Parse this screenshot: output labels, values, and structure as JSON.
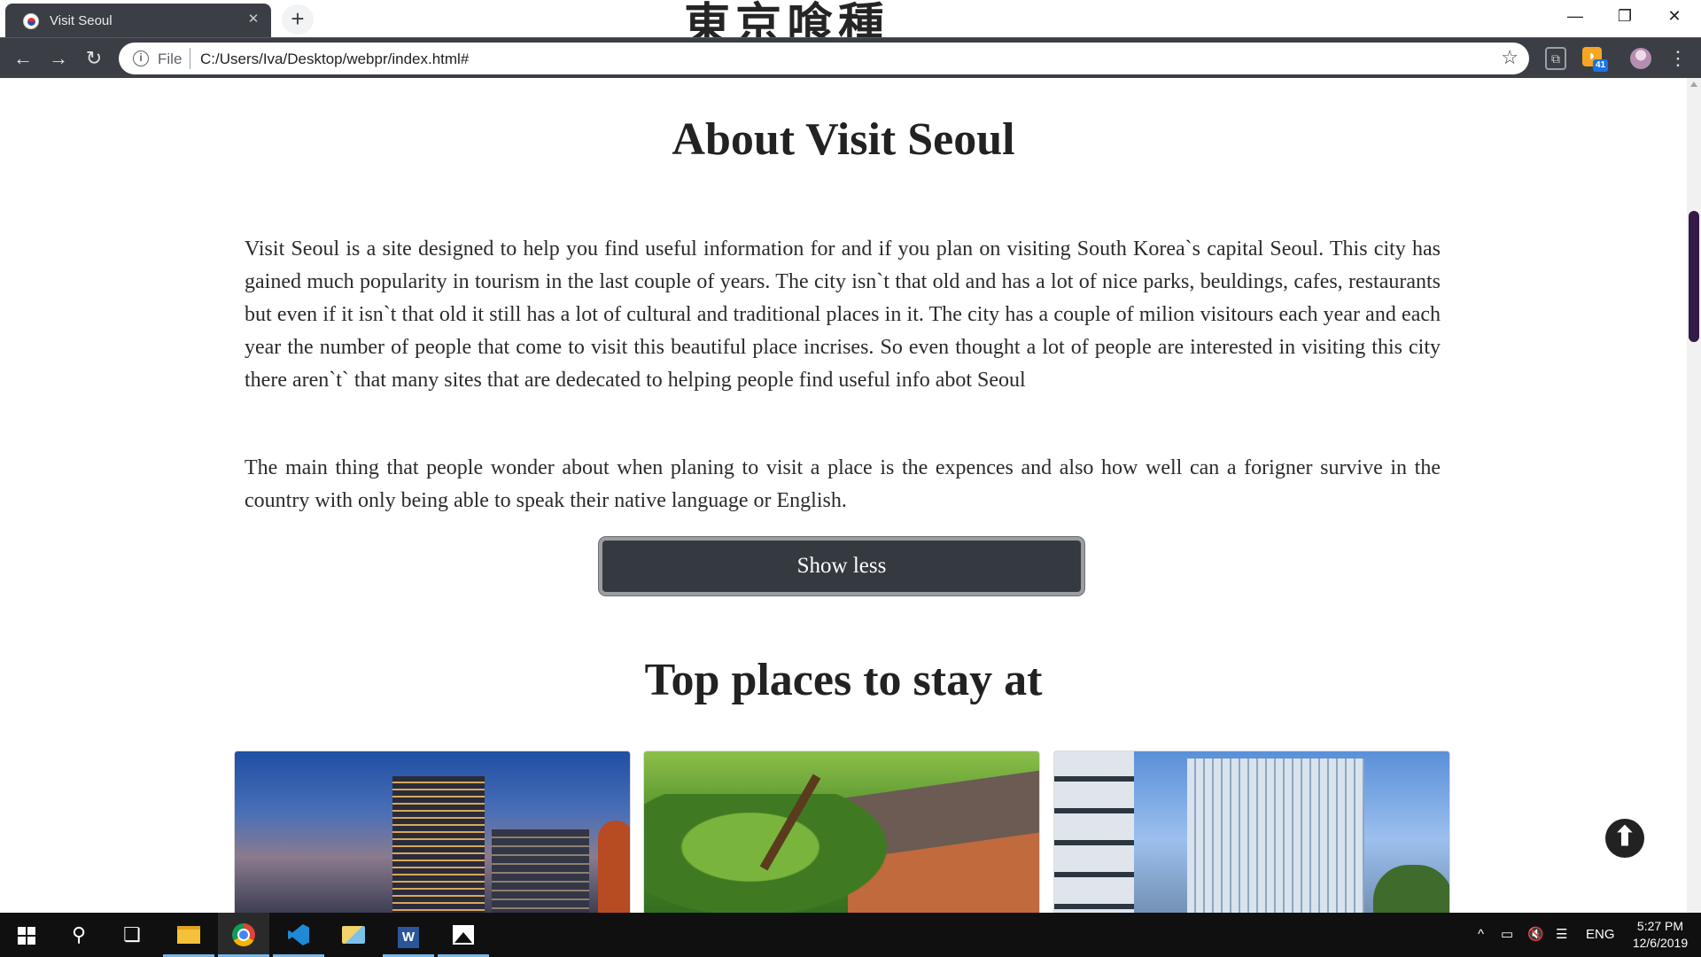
{
  "browser": {
    "tab_title": "Visit Seoul",
    "tab_close": "✕",
    "new_tab": "+",
    "banner_text": "東京喰種",
    "window_controls": {
      "minimize": "—",
      "restore": "❐",
      "close": "✕"
    },
    "nav": {
      "back": "←",
      "forward": "→",
      "reload": "↻"
    },
    "omnibox": {
      "info_icon": "i",
      "scheme": "File",
      "url": "C:/Users/Iva/Desktop/webpr/index.html#",
      "bookmark_icon": "☆"
    },
    "extensions": {
      "ext1": "⧉",
      "rss_icon": "◗",
      "rss_badge": "41"
    },
    "menu": "⋮"
  },
  "page": {
    "about_title": "About Visit Seoul",
    "paragraph1": "Visit Seoul is a site designed to help you find useful information for and if you plan on visiting South Korea`s capital Seoul. This city has gained much popularity in tourism in the last couple of years. The city isn`t that old and has a lot of nice parks, beuldings, cafes, restaurants but even if it isn`t that old it still has a lot of cultural and traditional places in it. The city has a couple of milion visitours each year and each year the number of people that come to visit this beautiful place incrises. So even thought a lot of people are interested in visiting this city there aren`t` that many sites that are dedecated to helping people find useful info abot Seoul",
    "paragraph2": "The main thing that people wonder about when planing to visit a place is the expences and also how well can a forigner survive in the country with only being able to speak their native language or English.",
    "show_less_label": "Show less",
    "places_title": "Top places to stay at",
    "back_to_top_icon": "⬆",
    "cards": [
      {
        "icon": "hotel-skyline-photo"
      },
      {
        "icon": "hanok-garden-photo"
      },
      {
        "icon": "glass-tower-photo"
      }
    ]
  },
  "taskbar": {
    "search_icon": "⚲",
    "taskview_icon": "❏",
    "tray": {
      "chevron": "^",
      "battery": "▭",
      "volume": "🔇",
      "notify": "☰",
      "lang": "ENG"
    },
    "time": "5:27 PM",
    "date": "12/6/2019"
  },
  "colors": {
    "chrome_dark": "#3b3f45",
    "button_bg": "#343a40",
    "scroll_thumb": "#341a46",
    "taskbar": "#101010",
    "accent": "#76b9ed"
  }
}
